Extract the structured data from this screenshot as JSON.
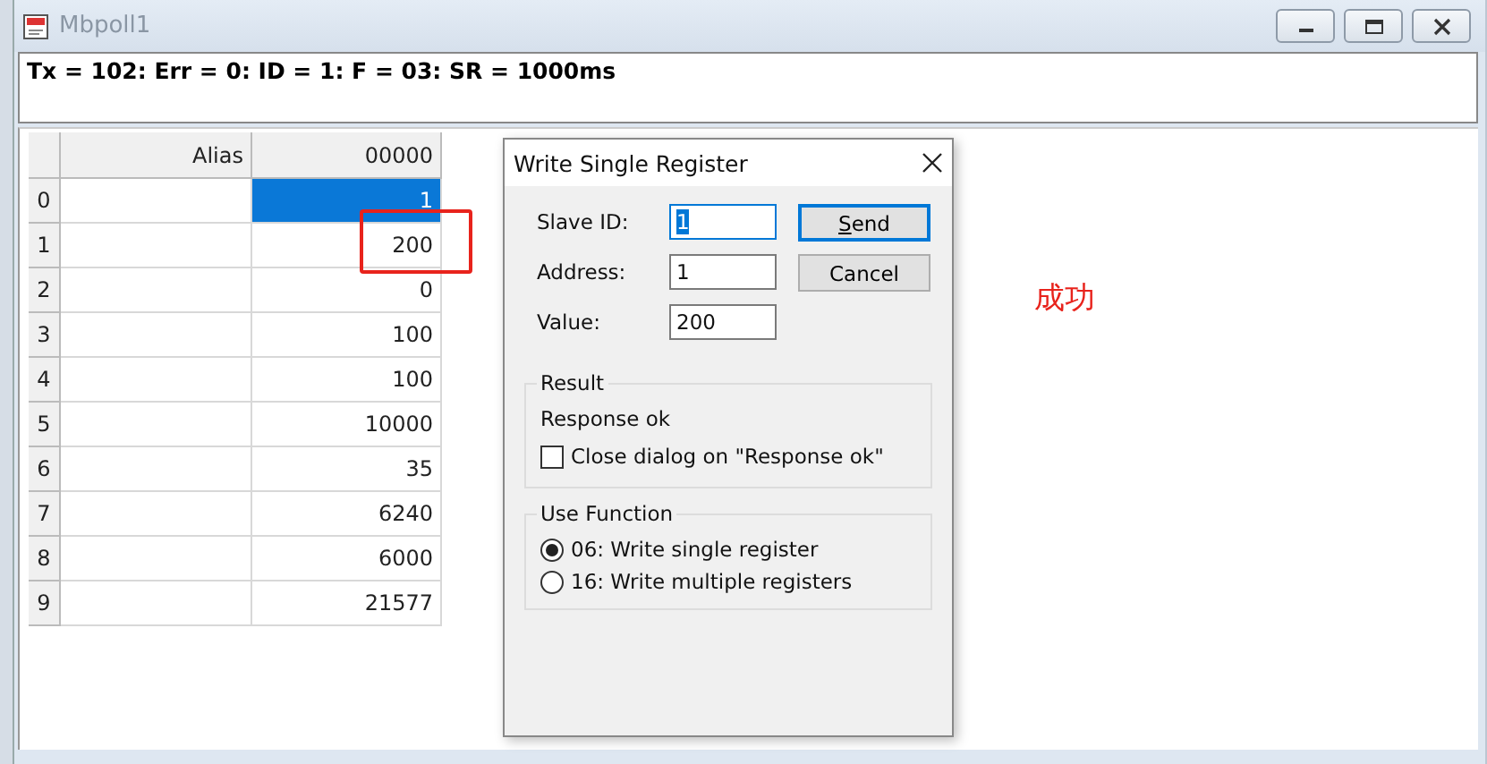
{
  "window": {
    "title": "Mbpoll1",
    "status": "Tx = 102: Err = 0: ID = 1: F = 03: SR = 1000ms"
  },
  "table": {
    "columns": [
      "Alias",
      "00000"
    ],
    "rows": [
      {
        "header": "0",
        "value": "1",
        "selected": true
      },
      {
        "header": "1",
        "value": "200",
        "selected": false
      },
      {
        "header": "2",
        "value": "0",
        "selected": false
      },
      {
        "header": "3",
        "value": "100",
        "selected": false
      },
      {
        "header": "4",
        "value": "100",
        "selected": false
      },
      {
        "header": "5",
        "value": "10000",
        "selected": false
      },
      {
        "header": "6",
        "value": "35",
        "selected": false
      },
      {
        "header": "7",
        "value": "6240",
        "selected": false
      },
      {
        "header": "8",
        "value": "6000",
        "selected": false
      },
      {
        "header": "9",
        "value": "21577",
        "selected": false
      }
    ]
  },
  "dialog": {
    "title": "Write Single Register",
    "fields": [
      {
        "label": "Slave ID:",
        "value": "1",
        "selected": true
      },
      {
        "label": "Address:",
        "value": "1",
        "selected": false
      },
      {
        "label": "Value:",
        "value": "200",
        "selected": false
      }
    ],
    "buttons": [
      {
        "label": "Send",
        "default": true
      },
      {
        "label": "Cancel",
        "default": false
      }
    ],
    "result": {
      "title": "Result",
      "message": "Response ok",
      "checkbox": {
        "label": "Close dialog on \"Response ok\"",
        "checked": false
      }
    },
    "function": {
      "title": "Use Function",
      "options": [
        {
          "label": "06: Write single register",
          "selected": true
        },
        {
          "label": "16: Write multiple registers",
          "selected": false
        }
      ]
    }
  },
  "annotation": {
    "text": "成功"
  }
}
